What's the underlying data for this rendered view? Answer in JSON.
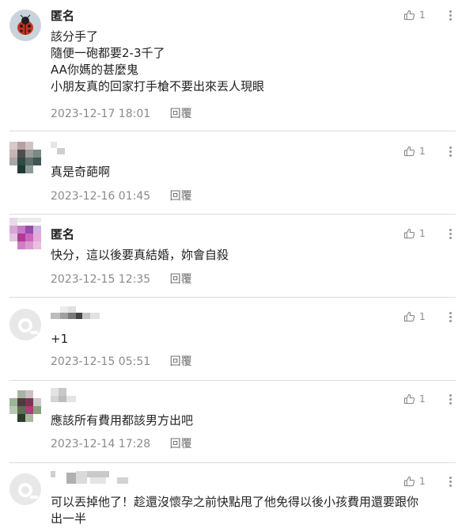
{
  "comments": [
    {
      "author": "匿名",
      "avatar": "ladybug-avatar",
      "lines": [
        "該分手了",
        "隨便一砲都要2-3千了",
        "AA你媽的甚麼鬼",
        "小朋友真的回家打手槍不要出來丟人現眼"
      ],
      "date": "2023-12-17 18:01",
      "reply": "回覆",
      "likes": "1"
    },
    {
      "author": "",
      "avatar": "pixelated-avatar",
      "lines": [
        "真是奇葩啊"
      ],
      "date": "2023-12-16 01:45",
      "reply": "回覆",
      "likes": "1"
    },
    {
      "author": "匿名",
      "avatar": "pixelated-avatar",
      "lines": [
        "快分，這以後要真結婚，妳會自殺"
      ],
      "date": "2023-12-15 12:35",
      "reply": "回覆",
      "likes": "1"
    },
    {
      "author": "",
      "avatar": "default-avatar",
      "lines": [
        "+1"
      ],
      "date": "2023-12-15 05:51",
      "reply": "回覆",
      "likes": "1"
    },
    {
      "author": "",
      "avatar": "pixelated-avatar",
      "lines": [
        "應該所有費用都該男方出吧"
      ],
      "date": "2023-12-14 17:28",
      "reply": "回覆",
      "likes": "1"
    },
    {
      "author": "",
      "avatar": "default-avatar",
      "lines": [
        "可以丟掉他了！趁還沒懷孕之前快點甩了他免得以後小孩費用還要跟你",
        "出一半"
      ],
      "date": "",
      "reply": "",
      "likes": "1"
    }
  ]
}
